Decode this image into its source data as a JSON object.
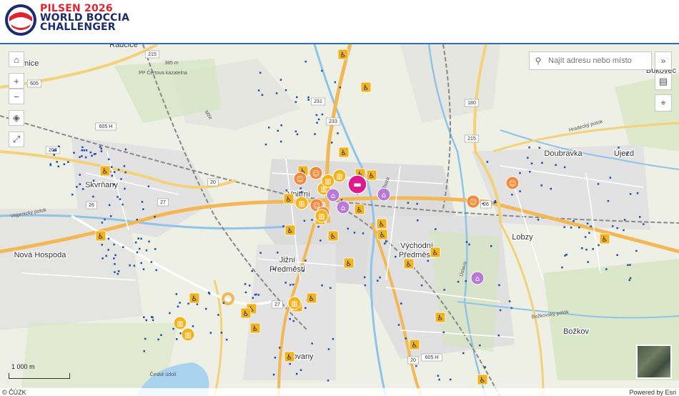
{
  "header": {
    "line1": "PILSEN 2026",
    "line2": "WORLD BOCCIA",
    "line3": "CHALLENGER"
  },
  "search": {
    "placeholder": "Najít adresu nebo místo"
  },
  "scale": {
    "label": "1 000 m"
  },
  "attribution": {
    "left": "© ČÚZK",
    "right": "Powered by Esri"
  },
  "places": [
    {
      "name": "Křimice"
    },
    {
      "name": "Skvrňany"
    },
    {
      "name": "Nová Hospoda"
    },
    {
      "name": "Jižní Předměstí"
    },
    {
      "name": "Východní Předměstí"
    },
    {
      "name": "Doubravka"
    },
    {
      "name": "Újezd"
    },
    {
      "name": "Lobzy"
    },
    {
      "name": "Božkov"
    },
    {
      "name": "Bukovec"
    },
    {
      "name": "Slovany"
    },
    {
      "name": "Radčice"
    },
    {
      "name": "Vnitřní"
    }
  ],
  "road_numbers": [
    "215",
    "605",
    "605 H",
    "203",
    "26",
    "27",
    "20",
    "231",
    "233",
    "180",
    "215",
    "605 H",
    "26",
    "27",
    "20"
  ],
  "minor_labels": [
    "PP Čertova kazatelna",
    "Vejprnický potok",
    "Hradecký potok",
    "Božkovský potok",
    "České údolí",
    "Radbuza",
    "Úslava",
    "Mže",
    "385 m"
  ],
  "poi_colors": {
    "accessible": "#f2b31c",
    "culture": "#f28a3c",
    "museum": "#b87ad6",
    "hotel": "#e0198d",
    "stop": "#1f4fa8"
  },
  "icons": [
    "home-icon",
    "zoom-in-icon",
    "zoom-out-icon",
    "compass-icon",
    "fullscreen-icon",
    "search-icon",
    "expand-icon",
    "layers-icon",
    "locate-icon"
  ]
}
